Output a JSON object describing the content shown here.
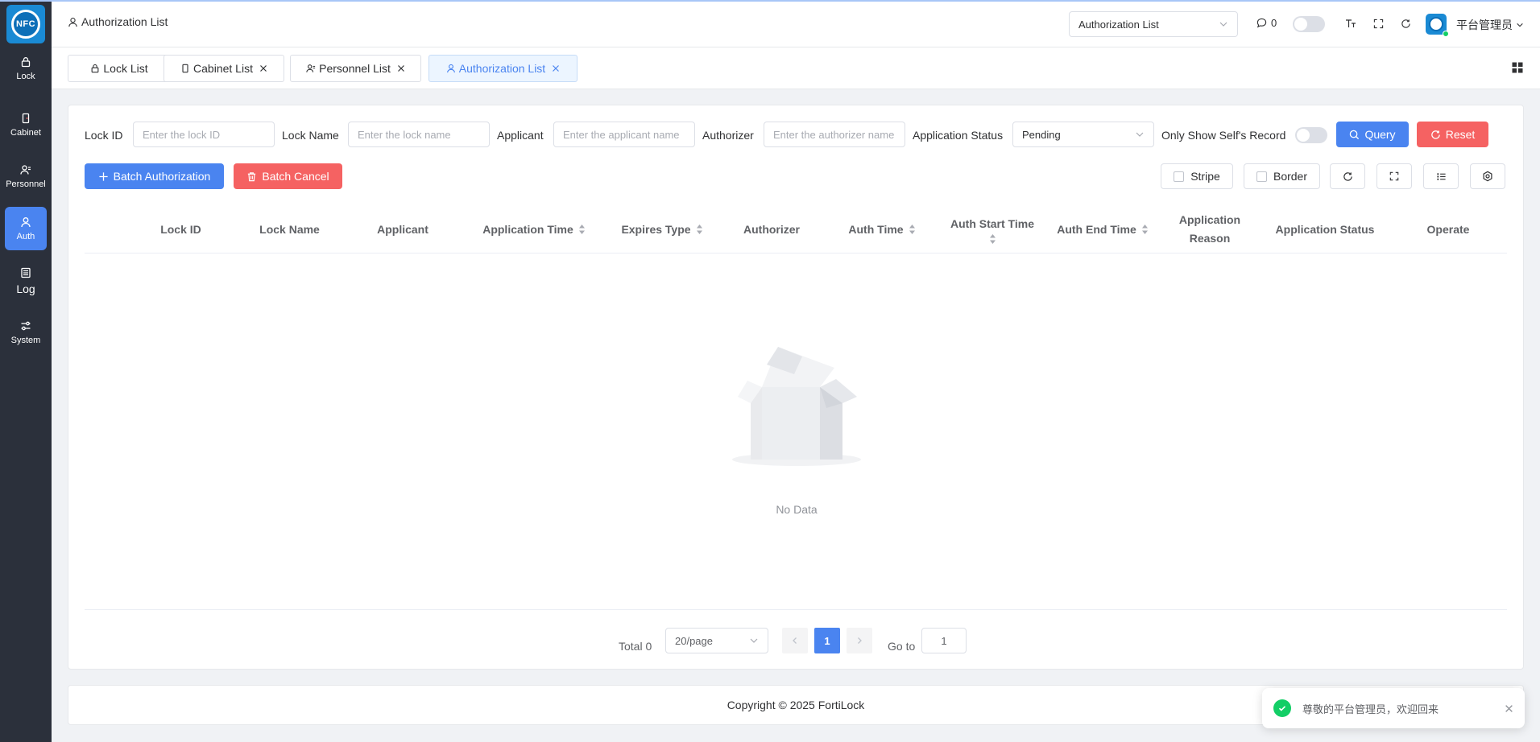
{
  "sidebar": {
    "logo_text": "NFC",
    "items": [
      {
        "label": "Lock",
        "icon": "lock-icon"
      },
      {
        "label": "Cabinet",
        "icon": "cabinet-icon"
      },
      {
        "label": "Personnel",
        "icon": "personnel-icon"
      },
      {
        "label": "Auth",
        "icon": "user-icon",
        "active": true
      },
      {
        "label": "Log",
        "icon": "log-icon"
      },
      {
        "label": "System",
        "icon": "settings-icon"
      }
    ]
  },
  "header": {
    "breadcrumb": "Authorization List",
    "menu_search_value": "Authorization List",
    "message_count": "0",
    "username": "平台管理员"
  },
  "tabs": [
    {
      "label": "Lock List",
      "closable": false,
      "active": false
    },
    {
      "label": "Cabinet List",
      "closable": true,
      "active": false
    },
    {
      "label": "Personnel List",
      "closable": true,
      "active": false
    },
    {
      "label": "Authorization List",
      "closable": true,
      "active": true
    }
  ],
  "filters": {
    "lock_id_label": "Lock ID",
    "lock_id_placeholder": "Enter the lock ID",
    "lock_name_label": "Lock Name",
    "lock_name_placeholder": "Enter the lock name",
    "applicant_label": "Applicant",
    "applicant_placeholder": "Enter the applicant name",
    "authorizer_label": "Authorizer",
    "authorizer_placeholder": "Enter the authorizer name",
    "status_label": "Application Status",
    "status_value": "Pending",
    "self_record_label": "Only Show Self's Record",
    "query_label": "Query",
    "reset_label": "Reset"
  },
  "toolbar": {
    "batch_auth_label": "Batch Authorization",
    "batch_cancel_label": "Batch Cancel",
    "stripe_label": "Stripe",
    "border_label": "Border"
  },
  "table": {
    "columns": {
      "lock_id": "Lock ID",
      "lock_name": "Lock Name",
      "applicant": "Applicant",
      "application_time": "Application Time",
      "expires_type": "Expires Type",
      "authorizer": "Authorizer",
      "auth_time": "Auth Time",
      "auth_start_time": "Auth Start Time",
      "auth_end_time": "Auth End Time",
      "application_reason_1": "Application",
      "application_reason_2": "Reason",
      "application_status": "Application Status",
      "operate": "Operate"
    },
    "empty_text": "No Data"
  },
  "pagination": {
    "total_label": "Total 0",
    "page_size": "20/page",
    "current_page": "1",
    "goto_label": "Go to",
    "goto_value": "1"
  },
  "footer": {
    "copyright": "Copyright © 2025 FortiLock"
  },
  "notification": {
    "message": "尊敬的平台管理员，欢迎回来"
  },
  "colors": {
    "primary": "#4a84f0",
    "danger": "#f56262",
    "sidebar": "#2b303b",
    "success": "#13ce66"
  }
}
